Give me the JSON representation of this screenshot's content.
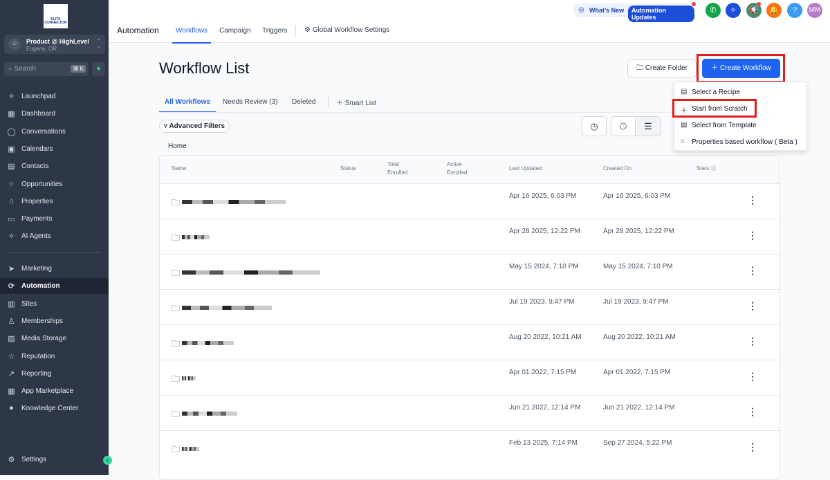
{
  "sidebar": {
    "logo_text": "ELITE CONNECTOR",
    "account": {
      "name": "Product @ HighLevel",
      "location": "Eugene, OR"
    },
    "search": {
      "placeholder": "Search",
      "shortcut": "⌘ K"
    },
    "items": [
      {
        "label": "Launchpad",
        "icon": "rocket-icon"
      },
      {
        "label": "Dashboard",
        "icon": "dashboard-icon"
      },
      {
        "label": "Conversations",
        "icon": "chat-icon"
      },
      {
        "label": "Calendars",
        "icon": "calendar-icon"
      },
      {
        "label": "Contacts",
        "icon": "contacts-icon"
      },
      {
        "label": "Opportunities",
        "icon": "opportunities-icon"
      },
      {
        "label": "Properties",
        "icon": "home-icon"
      },
      {
        "label": "Payments",
        "icon": "payments-icon"
      },
      {
        "label": "AI Agents",
        "icon": "sparkle-icon"
      }
    ],
    "items2": [
      {
        "label": "Marketing",
        "icon": "send-icon"
      },
      {
        "label": "Automation",
        "icon": "automation-icon",
        "active": true
      },
      {
        "label": "Sites",
        "icon": "sites-icon"
      },
      {
        "label": "Memberships",
        "icon": "memberships-icon"
      },
      {
        "label": "Media Storage",
        "icon": "image-icon"
      },
      {
        "label": "Reputation",
        "icon": "star-icon"
      },
      {
        "label": "Reporting",
        "icon": "chart-icon"
      },
      {
        "label": "App Marketplace",
        "icon": "apps-icon"
      },
      {
        "label": "Knowledge Center",
        "icon": "info-icon"
      }
    ],
    "settings": "Settings"
  },
  "header": {
    "title": "Automation",
    "tabs": [
      "Workflows",
      "Campaign",
      "Triggers"
    ],
    "global_settings": "Global Workflow Settings",
    "whats_new": "What's New",
    "automation_updates": "Automation Updates",
    "avatar": "MM",
    "help": "?"
  },
  "page": {
    "title": "Workflow List",
    "create_folder": "Create Folder",
    "create_workflow": "Create Workflow",
    "list_tabs": [
      "All Workflows",
      "Needs Review (3)",
      "Deleted"
    ],
    "smart_list": "Smart List",
    "advanced_filters": "Advanced Filters",
    "breadcrumb": "Home"
  },
  "menu": [
    {
      "label": "Select a Recipe",
      "icon": "recipe-icon"
    },
    {
      "label": "Start from Scratch",
      "icon": "plus-icon"
    },
    {
      "label": "Select from Template",
      "icon": "template-icon"
    },
    {
      "label": "Properties based workflow ( Beta )",
      "icon": "home-icon"
    }
  ],
  "table": {
    "columns": [
      "Name",
      "Status",
      "Total Enrolled",
      "Active Enrolled",
      "Last Updated",
      "Created On",
      "Stats"
    ],
    "rows": [
      {
        "updated": "Apr 16 2025, 6:03 PM",
        "created": "Apr 16 2025, 6:03 PM"
      },
      {
        "updated": "Apr 28 2025, 12:22 PM",
        "created": "Apr 28 2025, 12:22 PM"
      },
      {
        "updated": "May 15 2024, 7:10 PM",
        "created": "May 15 2024, 7:10 PM"
      },
      {
        "updated": "Jul 19 2023, 9:47 PM",
        "created": "Jul 19 2023, 9:47 PM"
      },
      {
        "updated": "Aug 20 2022, 10:21 AM",
        "created": "Aug 20 2022, 10:21 AM"
      },
      {
        "updated": "Apr 01 2022, 7:15 PM",
        "created": "Apr 01 2022, 7:15 PM"
      },
      {
        "updated": "Jun 21 2022, 12:14 PM",
        "created": "Jun 21 2022, 12:14 PM"
      },
      {
        "updated": "Feb 13 2025, 7:14 PM",
        "created": "Sep 27 2024, 5:22 PM"
      }
    ]
  }
}
